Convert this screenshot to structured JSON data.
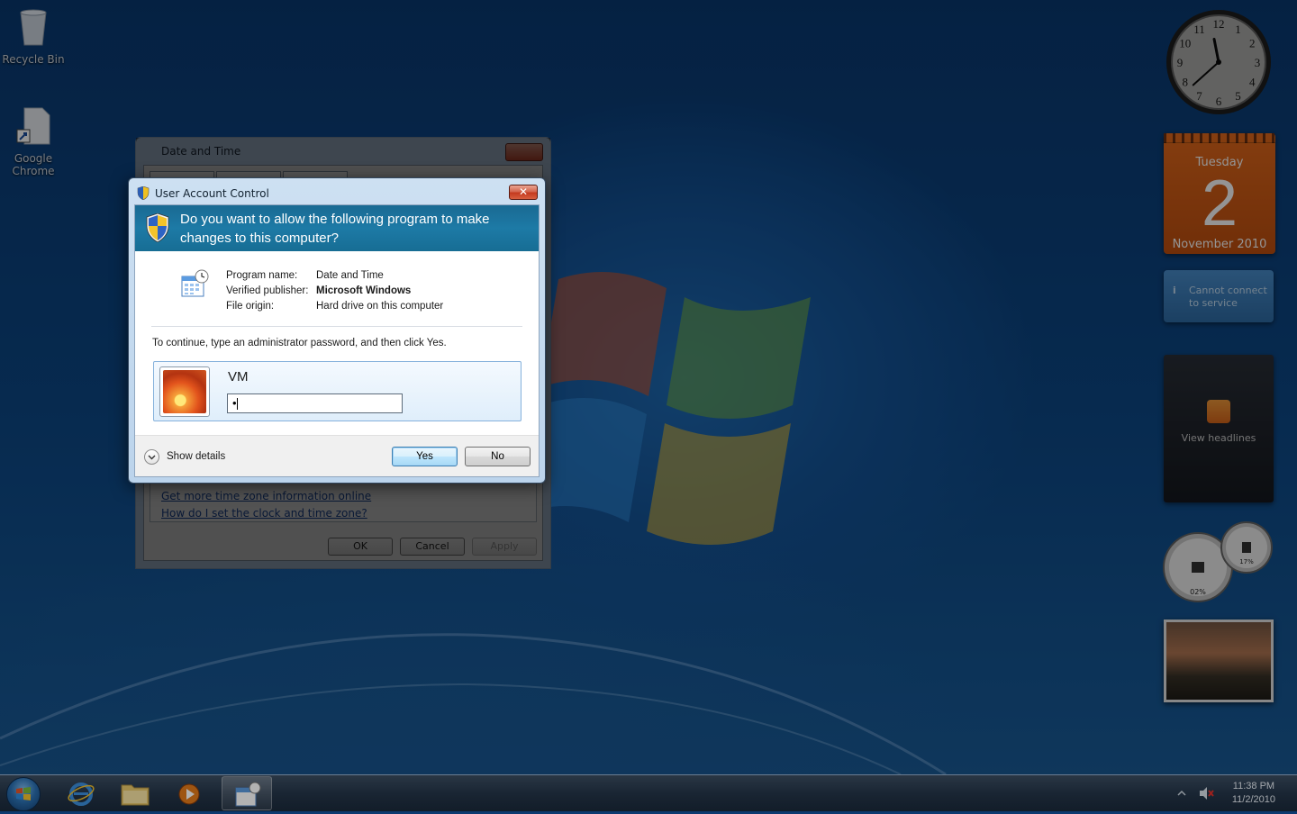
{
  "desktop": {
    "icons": [
      {
        "label": "Recycle Bin",
        "icon": "recycle-bin-icon"
      },
      {
        "label": "Google Chrome",
        "icon": "chrome-shortcut-icon"
      }
    ]
  },
  "gadgets": {
    "clock": {
      "numerals": [
        "12",
        "1",
        "2",
        "3",
        "4",
        "5",
        "6",
        "7",
        "8",
        "9",
        "10",
        "11"
      ],
      "hour": 11,
      "minute": 38
    },
    "calendar": {
      "day_name": "Tuesday",
      "day_number": "2",
      "month_year": "November 2010"
    },
    "feed_error": {
      "text": "Cannot connect to service"
    },
    "headlines": {
      "label": "View headlines"
    },
    "meter": {
      "cpu": "02%",
      "memory": "17%"
    }
  },
  "background_window": {
    "title": "Date and Time",
    "links": [
      "Get more time zone information online",
      "How do I set the clock and time zone?"
    ],
    "buttons": {
      "ok": "OK",
      "cancel": "Cancel",
      "apply": "Apply"
    }
  },
  "uac": {
    "title": "User Account Control",
    "close_glyph": "✕",
    "question": "Do you want to allow the following program to make changes to this computer?",
    "program_name_label": "Program name:",
    "program_name": "Date and Time",
    "publisher_label": "Verified publisher:",
    "publisher": "Microsoft Windows",
    "origin_label": "File origin:",
    "origin": "Hard drive on this computer",
    "instruction": "To continue, type an administrator password, and then click Yes.",
    "username": "VM",
    "password_value": "•",
    "show_details": "Show details",
    "yes_label": "Yes",
    "no_label": "No"
  },
  "taskbar": {
    "time": "11:38 PM",
    "date": "11/2/2010"
  },
  "colors": {
    "uac_banner": "#1d7aa6",
    "calendar": "#d65a15",
    "desktop": "#0d4a8a"
  }
}
